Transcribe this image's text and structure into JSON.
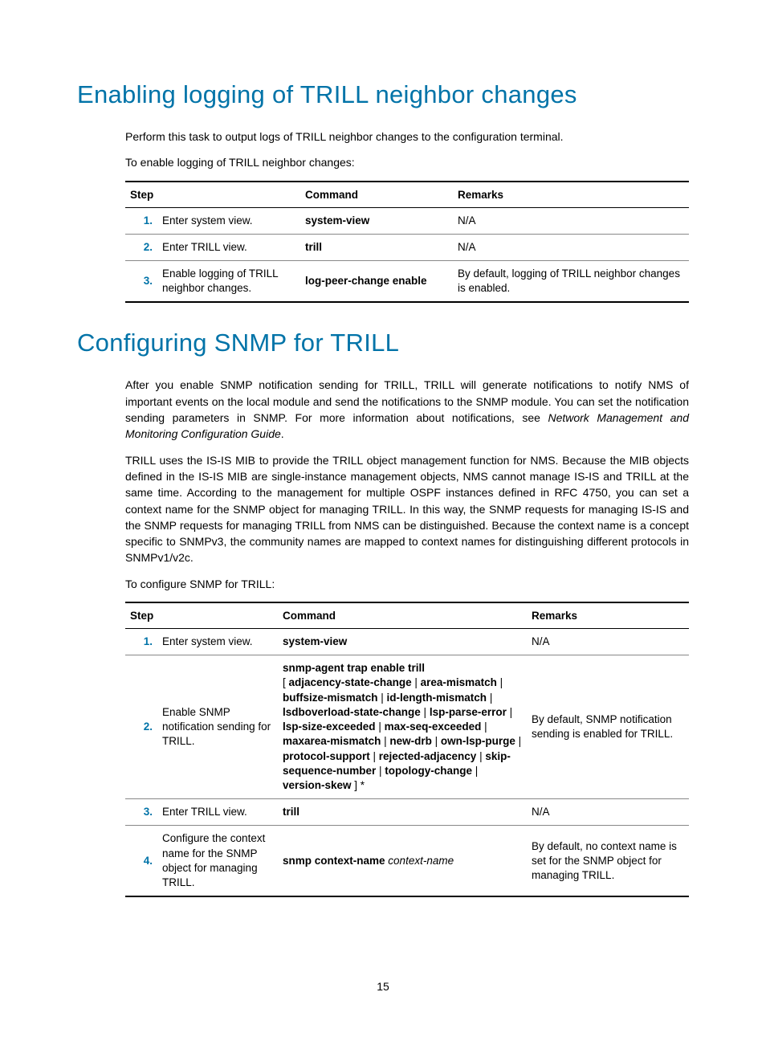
{
  "section1": {
    "heading": "Enabling logging of TRILL neighbor changes",
    "para1": "Perform this task to output logs of TRILL neighbor changes to the configuration terminal.",
    "para2": "To enable logging of TRILL neighbor changes:",
    "table": {
      "headers": {
        "step": "Step",
        "command": "Command",
        "remarks": "Remarks"
      },
      "rows": [
        {
          "num": "1.",
          "step": "Enter system view.",
          "command": "system-view",
          "remarks": "N/A"
        },
        {
          "num": "2.",
          "step": "Enter TRILL view.",
          "command": "trill",
          "remarks": "N/A"
        },
        {
          "num": "3.",
          "step": "Enable logging of TRILL neighbor changes.",
          "command": "log-peer-change enable",
          "remarks": "By default, logging of TRILL neighbor changes is enabled."
        }
      ]
    }
  },
  "section2": {
    "heading": "Configuring SNMP for TRILL",
    "para1a": "After you enable SNMP notification sending for TRILL, TRILL will generate notifications to notify NMS of important events on the local module and send the notifications to the SNMP module. You can set the notification sending parameters in SNMP. For more information about notifications, see ",
    "para1b": "Network Management and Monitoring Configuration Guide",
    "para1c": ".",
    "para2": "TRILL uses the IS-IS MIB to provide the TRILL object management function for NMS. Because the MIB objects defined in the IS-IS MIB are single-instance management objects, NMS cannot manage IS-IS and TRILL at the same time. According to the management for multiple OSPF instances defined in RFC 4750, you can set a context name for the SNMP object for managing TRILL. In this way, the SNMP requests for managing IS-IS and the SNMP requests for managing TRILL from NMS can be distinguished. Because the context name is a concept specific to SNMPv3, the community names are mapped to context names for distinguishing different protocols in SNMPv1/v2c.",
    "para3": "To configure SNMP for TRILL:",
    "table": {
      "headers": {
        "step": "Step",
        "command": "Command",
        "remarks": "Remarks"
      },
      "rows": [
        {
          "num": "1.",
          "step": "Enter system view.",
          "command_html": "<span class=\"cmd-bold\">system-view</span>",
          "remarks": "N/A"
        },
        {
          "num": "2.",
          "step": "Enable SNMP notification sending for TRILL.",
          "command_html": "<span class=\"cmd-bold\">snmp-agent trap enable trill</span><br>[ <span class=\"cmd-bold\">adjacency-state-change</span> | <span class=\"cmd-bold\">area-mismatch</span> | <span class=\"cmd-bold\">buffsize-mismatch</span> | <span class=\"cmd-bold\">id-length-mismatch</span> | <span class=\"cmd-bold\">lsdboverload-state-change</span> | <span class=\"cmd-bold\">lsp-parse-error</span> | <span class=\"cmd-bold\">lsp-size-exceeded</span> | <span class=\"cmd-bold\">max-seq-exceeded</span> | <span class=\"cmd-bold\">maxarea-mismatch</span> | <span class=\"cmd-bold\">new-drb</span> | <span class=\"cmd-bold\">own-lsp-purge</span> | <span class=\"cmd-bold\">protocol-support</span> | <span class=\"cmd-bold\">rejected-adjacency</span> | <span class=\"cmd-bold\">skip-sequence-number</span> | <span class=\"cmd-bold\">topology-change</span> | <span class=\"cmd-bold\">version-skew</span> ] *",
          "remarks": "By default, SNMP notification sending is enabled for TRILL."
        },
        {
          "num": "3.",
          "step": "Enter TRILL view.",
          "command_html": "<span class=\"cmd-bold\">trill</span>",
          "remarks": "N/A"
        },
        {
          "num": "4.",
          "step": "Configure the context name for the SNMP object for managing TRILL.",
          "command_html": "<span class=\"cmd-bold\">snmp context-name</span> <span class=\"cmd-ital\">context-name</span>",
          "remarks": "By default, no context name is set for the SNMP object for managing TRILL."
        }
      ]
    }
  },
  "page_number": "15"
}
